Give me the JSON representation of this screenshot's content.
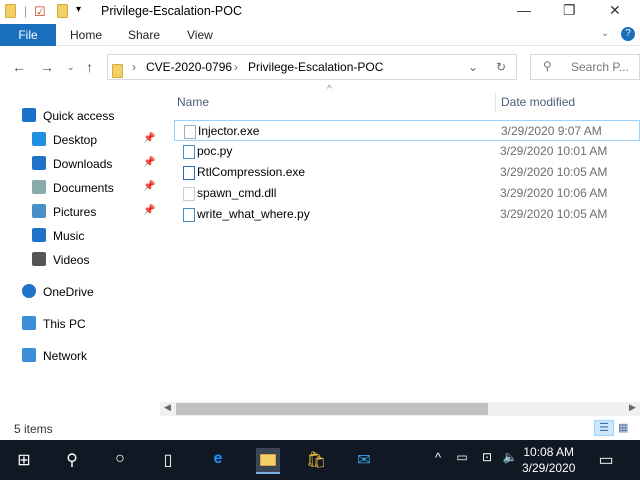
{
  "window": {
    "title": "Privilege-Escalation-POC"
  },
  "ribbon": {
    "file": "File",
    "tabs": [
      "Home",
      "Share",
      "View"
    ]
  },
  "address": {
    "crumbs": [
      "CVE-2020-0796",
      "Privilege-Escalation-POC"
    ]
  },
  "search": {
    "placeholder": "Search P..."
  },
  "nav": [
    {
      "label": "Quick access",
      "icon": "star-icon",
      "color": "#1a73c8"
    },
    {
      "label": "Desktop",
      "icon": "desktop-icon",
      "color": "#1e90e0",
      "pinned": true
    },
    {
      "label": "Downloads",
      "icon": "download-icon",
      "color": "#1e73c8",
      "pinned": true
    },
    {
      "label": "Documents",
      "icon": "documents-icon",
      "color": "#8aa",
      "pinned": true
    },
    {
      "label": "Pictures",
      "icon": "pictures-icon",
      "color": "#4a90c8",
      "pinned": true
    },
    {
      "label": "Music",
      "icon": "music-icon",
      "color": "#1e73c8"
    },
    {
      "label": "Videos",
      "icon": "videos-icon",
      "color": "#555"
    },
    {
      "label": "OneDrive",
      "icon": "cloud-icon",
      "color": "#1e73c8"
    },
    {
      "label": "This PC",
      "icon": "computer-icon",
      "color": "#3a8fd8"
    },
    {
      "label": "Network",
      "icon": "network-icon",
      "color": "#3a8fd8"
    }
  ],
  "columns": {
    "name": "Name",
    "date": "Date modified"
  },
  "files": [
    {
      "name": "Injector.exe",
      "date": "3/29/2020 9:07 AM",
      "icon": "exe-injector-icon"
    },
    {
      "name": "poc.py",
      "date": "3/29/2020 10:01 AM",
      "icon": "python-file-icon"
    },
    {
      "name": "RtlCompression.exe",
      "date": "3/29/2020 10:05 AM",
      "icon": "exe-window-icon"
    },
    {
      "name": "spawn_cmd.dll",
      "date": "3/29/2020 10:06 AM",
      "icon": "dll-file-icon"
    },
    {
      "name": "write_what_where.py",
      "date": "3/29/2020 10:05 AM",
      "icon": "python-file-icon"
    }
  ],
  "status": {
    "items": "5 items"
  },
  "taskbar": {
    "time": "10:08 AM",
    "date": "3/29/2020"
  }
}
